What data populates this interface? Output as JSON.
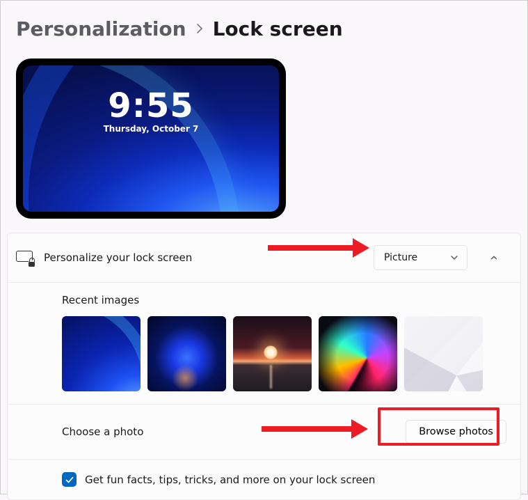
{
  "breadcrumb": {
    "parent": "Personalization",
    "current": "Lock screen"
  },
  "preview": {
    "time": "9:55",
    "date": "Thursday, October 7"
  },
  "personalize": {
    "label": "Personalize your lock screen",
    "dropdown_value": "Picture"
  },
  "recent": {
    "title": "Recent images"
  },
  "choose": {
    "label": "Choose a photo",
    "button": "Browse photos"
  },
  "funfacts": {
    "checked": true,
    "label": "Get fun facts, tips, tricks, and more on your lock screen"
  }
}
